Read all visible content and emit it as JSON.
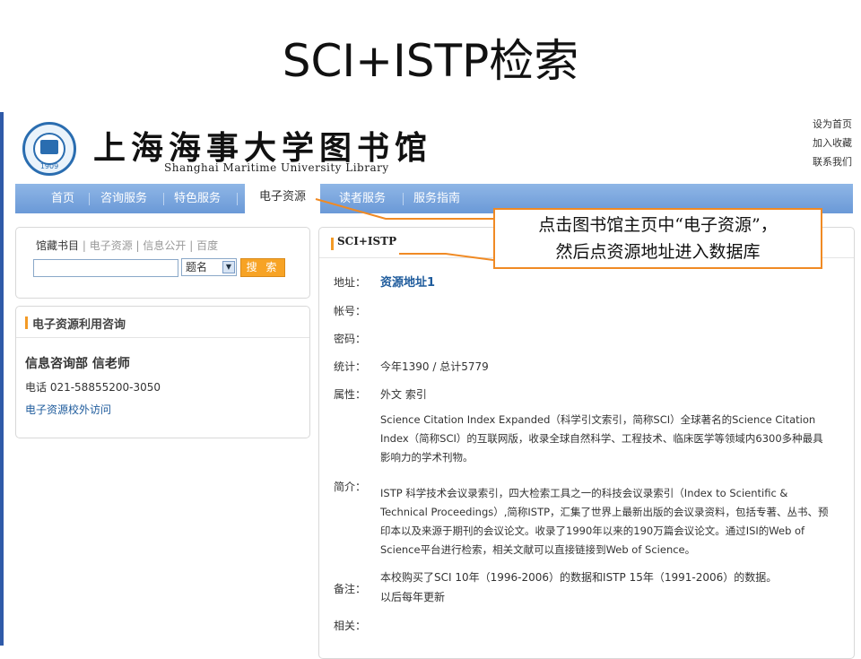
{
  "slide": {
    "title": "SCI+ISTP检索"
  },
  "header": {
    "library_name_cn": "上海海事大学图书馆",
    "library_name_en": "Shanghai Maritime University Library",
    "logo_year": "1909",
    "links": [
      "设为首页",
      "加入收藏",
      "联系我们"
    ]
  },
  "nav": {
    "items": [
      "首页",
      "咨询服务",
      "特色服务",
      "电子资源",
      "读者服务",
      "服务指南"
    ],
    "active": "电子资源"
  },
  "callout": {
    "line1": "点击图书馆主页中“电子资源”，",
    "line2": "然后点资源地址进入数据库"
  },
  "search": {
    "tabs": [
      "馆藏书目",
      "电子资源",
      "信息公开",
      "百度"
    ],
    "input_value": "",
    "select_value": "题名",
    "button_label": "搜 索"
  },
  "consult": {
    "title": "电子资源利用咨询",
    "name": "信息咨询部 信老师",
    "phone": "电话 021-58855200-3050",
    "link": "电子资源校外访问"
  },
  "resource": {
    "title": "SCI+ISTP",
    "labels": {
      "address": "地址：",
      "account": "帐号：",
      "password": "密码：",
      "stats": "统计：",
      "attr": "属性：",
      "intro": "简介：",
      "note": "备注：",
      "related": "相关："
    },
    "address_link": "资源地址1",
    "stats": "今年1390 / 总计5779",
    "attr": "外文 索引",
    "intro_sci": "Science Citation Index Expanded（科学引文索引，简称SCI）全球著名的Science Citation Index（简称SCI）的互联网版，收录全球自然科学、工程技术、临床医学等领域内6300多种最具影响力的学术刊物。",
    "intro_istp": "ISTP 科学技术会议录索引，四大检索工具之一的科技会议录索引（Index to Scientific & Technical Proceedings）,简称ISTP，汇集了世界上最新出版的会议录资料，包括专著、丛书、预印本以及来源于期刊的会议论文。收录了1990年以来的190万篇会议论文。通过ISI的Web of Science平台进行检索，相关文献可以直接链接到Web of Science。",
    "note_line1": "本校购买了SCI 10年（1996-2006）的数据和ISTP 15年（1991-2006）的数据。",
    "note_line2": "以后每年更新"
  },
  "colors": {
    "accent_orange": "#f08a24",
    "nav_blue": "#7aa6dd",
    "link_blue": "#1e5b9c"
  }
}
